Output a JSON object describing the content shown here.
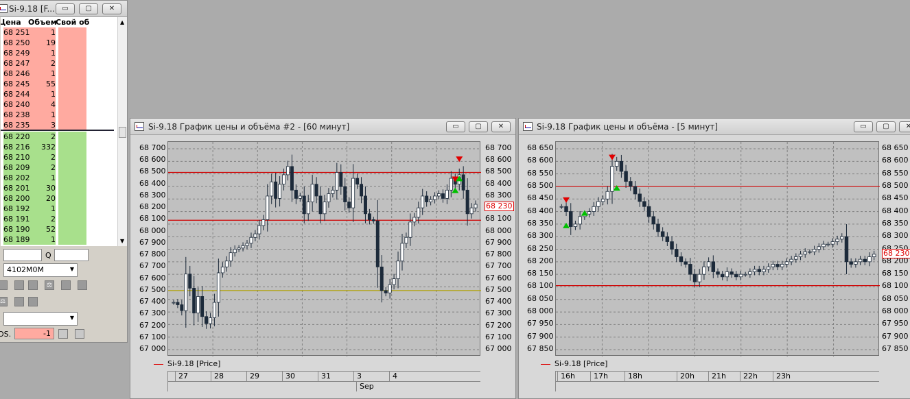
{
  "book_window": {
    "title": "Si-9.18 [F...",
    "min": "▭",
    "max": "▢",
    "close": "✕",
    "columns": [
      "Цена",
      "Объем",
      "Свой об"
    ],
    "asks": [
      {
        "price": "68 251",
        "vol": "1"
      },
      {
        "price": "68 250",
        "vol": "19"
      },
      {
        "price": "68 249",
        "vol": "1"
      },
      {
        "price": "68 247",
        "vol": "2"
      },
      {
        "price": "68 246",
        "vol": "1"
      },
      {
        "price": "68 245",
        "vol": "55"
      },
      {
        "price": "68 244",
        "vol": "1"
      },
      {
        "price": "68 240",
        "vol": "4"
      },
      {
        "price": "68 238",
        "vol": "1"
      },
      {
        "price": "68 235",
        "vol": "3"
      }
    ],
    "bids": [
      {
        "price": "68 220",
        "vol": "2"
      },
      {
        "price": "68 216",
        "vol": "332"
      },
      {
        "price": "68 210",
        "vol": "2"
      },
      {
        "price": "68 209",
        "vol": "2"
      },
      {
        "price": "68 202",
        "vol": "1"
      },
      {
        "price": "68 201",
        "vol": "30"
      },
      {
        "price": "68 200",
        "vol": "20"
      },
      {
        "price": "68 192",
        "vol": "1"
      },
      {
        "price": "68 191",
        "vol": "2"
      },
      {
        "price": "68 190",
        "vol": "52"
      },
      {
        "price": "68 189",
        "vol": "1"
      }
    ],
    "qty_label": "Q",
    "account": "4102M0M",
    "pos_label": "OS.",
    "pos_value": "-1"
  },
  "chart60": {
    "title": "Si-9.18 График цены и объёма #2 - [60 минут]",
    "legend": "Si-9.18 [Price]",
    "price_tag": "68 230",
    "y_ticks": [
      "68 700",
      "68 600",
      "68 500",
      "68 400",
      "68 300",
      "68 200",
      "68 100",
      "68 000",
      "67 900",
      "67 800",
      "67 700",
      "67 600",
      "67 500",
      "67 400",
      "67 300",
      "67 200",
      "67 100",
      "67 000"
    ],
    "x_days": [
      "27",
      "28",
      "29",
      "30",
      "31",
      "3",
      "4"
    ],
    "x_month": "Sep",
    "levels": [
      68500,
      68095,
      67500
    ],
    "level_colors": [
      "#d00000",
      "#d00000",
      "#b0a000"
    ]
  },
  "chart5": {
    "title": "Si-9.18 График цены и объёма - [5 минут]",
    "legend": "Si-9.18 [Price]",
    "price_tag": "68 230",
    "y_ticks": [
      "68 650",
      "68 600",
      "68 550",
      "68 500",
      "68 450",
      "68 400",
      "68 350",
      "68 300",
      "68 250",
      "68 200",
      "68 150",
      "68 100",
      "68 050",
      "68 000",
      "67 950",
      "67 900",
      "67 850"
    ],
    "x_hours": [
      "16h",
      "17h",
      "18h",
      "20h",
      "21h",
      "22h",
      "23h"
    ],
    "levels": [
      68500,
      68105
    ],
    "level_colors": [
      "#d00000",
      "#d00000"
    ]
  },
  "colors": {
    "background": "#ababab",
    "plot_bg": "#c0c0c0",
    "candle": "#1c2a3a",
    "ask": "#ffaaa0",
    "bid": "#a8e08c",
    "buy_marker": "#00c000",
    "sell_marker": "#e00000"
  },
  "chart_data": [
    {
      "type": "candlestick",
      "title": "Si-9.18 График цены и объёма #2 - [60 минут]",
      "ylim": [
        67000,
        68700
      ],
      "x_labels": [
        "27",
        "28",
        "29",
        "30",
        "31",
        "3",
        "4"
      ],
      "x_month": "Sep",
      "series": [
        {
          "name": "Si-9.18 [Price]",
          "close": [
            67400,
            67380,
            67330,
            67640,
            67520,
            67310,
            67450,
            67280,
            67220,
            67270,
            67400,
            67650,
            67700,
            67750,
            67820,
            67850,
            67860,
            67880,
            67900,
            67950,
            67980,
            68050,
            68100,
            68300,
            68420,
            68280,
            68400,
            68480,
            68550,
            68350,
            68280,
            68300,
            68150,
            68250,
            68400,
            68300,
            68150,
            68250,
            68320,
            68350,
            68500,
            68380,
            68250,
            68200,
            68450,
            68400,
            68300,
            68150,
            68100,
            68090,
            67700,
            67500,
            67480,
            67550,
            67600,
            67750,
            67900,
            67950,
            68080,
            68120,
            68200,
            68300,
            68250,
            68270,
            68300,
            68320,
            68280,
            68350,
            68450,
            68400,
            68480,
            68350,
            68150,
            68200,
            68230
          ]
        }
      ],
      "last_price": 68230,
      "horizontal_levels": [
        68500,
        68095,
        67500
      ]
    },
    {
      "type": "candlestick",
      "title": "Si-9.18 График цены и объёма - [5 минут]",
      "ylim": [
        67850,
        68650
      ],
      "x_labels": [
        "16h",
        "17h",
        "18h",
        "20h",
        "21h",
        "22h",
        "23h"
      ],
      "series": [
        {
          "name": "Si-9.18 [Price]",
          "close": [
            68420,
            68400,
            68340,
            68350,
            68380,
            68390,
            68400,
            68420,
            68440,
            68450,
            68480,
            68580,
            68600,
            68560,
            68520,
            68500,
            68470,
            68440,
            68420,
            68380,
            68350,
            68320,
            68300,
            68280,
            68250,
            68220,
            68200,
            68190,
            68150,
            68120,
            68150,
            68180,
            68200,
            68160,
            68150,
            68140,
            68160,
            68150,
            68140,
            68150,
            68150,
            68160,
            68170,
            68160,
            68170,
            68180,
            68190,
            68180,
            68190,
            68200,
            68210,
            68220,
            68230,
            68240,
            68240,
            68250,
            68260,
            68270,
            68270,
            68280,
            68290,
            68300,
            68200,
            68190,
            68200,
            68210,
            68200,
            68220,
            68230
          ]
        }
      ],
      "last_price": 68230,
      "horizontal_levels": [
        68500,
        68105
      ]
    }
  ]
}
